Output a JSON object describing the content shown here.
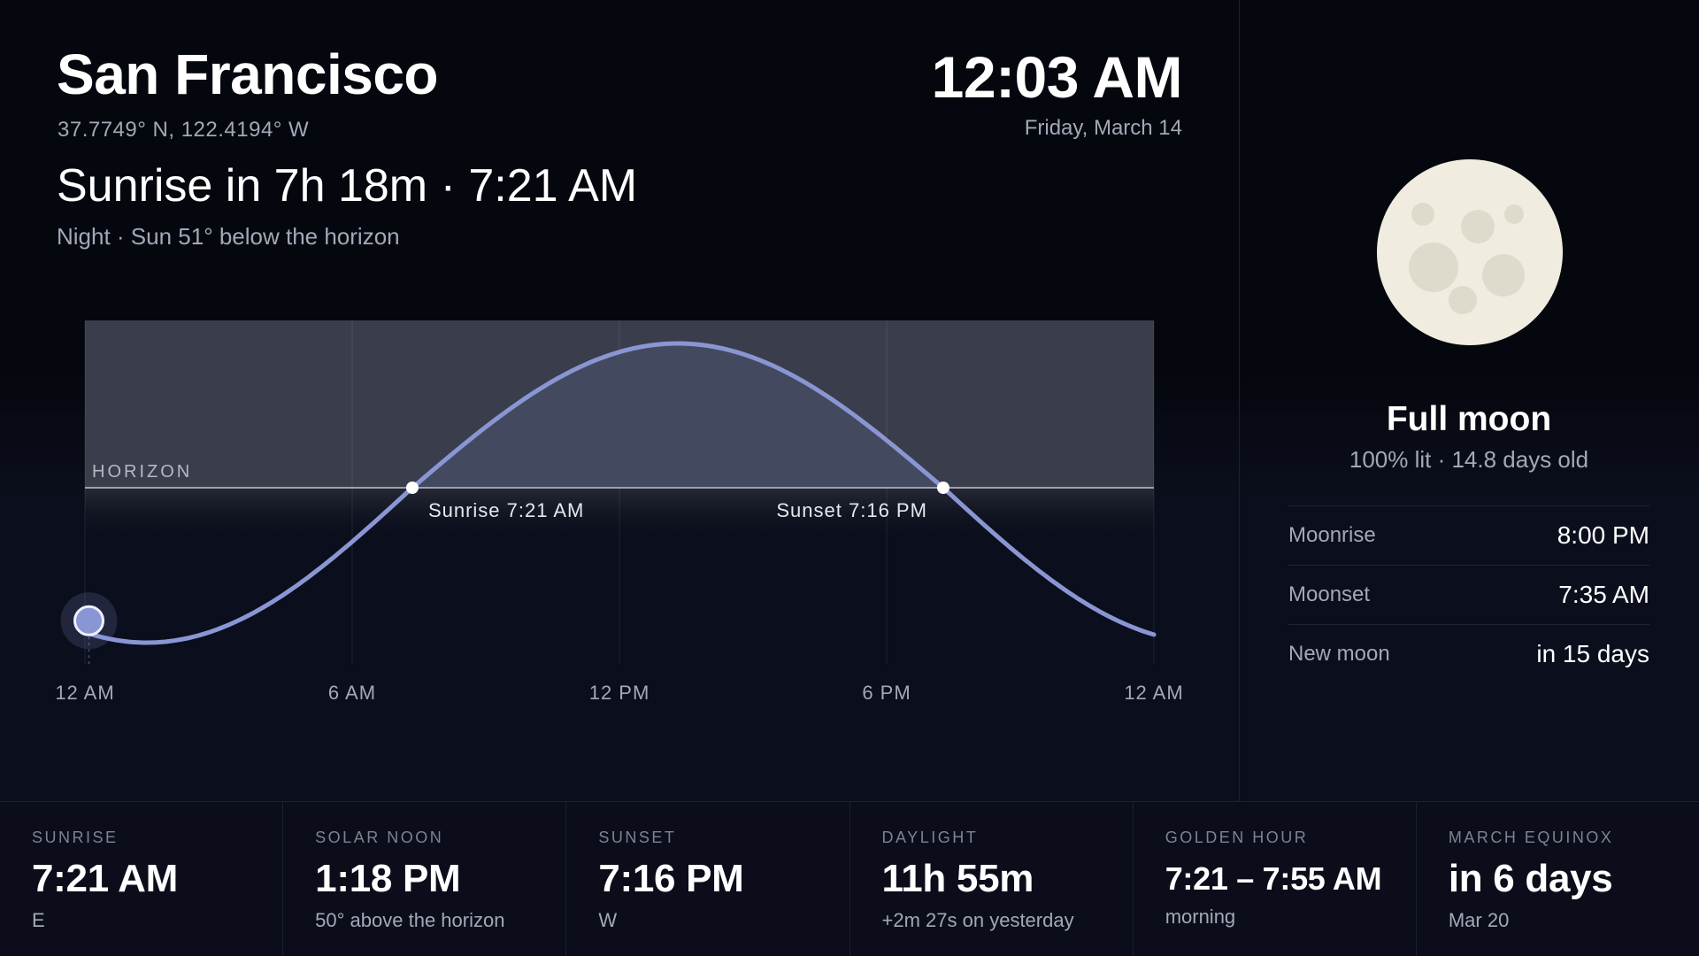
{
  "header": {
    "city": "San Francisco",
    "coords": "37.7749° N, 122.4194° W",
    "time": "12:03 AM",
    "date": "Friday, March 14",
    "headline": "Sunrise in 7h 18m · 7:21 AM",
    "subline": "Night · Sun 51° below the horizon"
  },
  "chart_data": {
    "type": "area",
    "horizon_label": "HORIZON",
    "x_ticks": [
      "12 AM",
      "6 AM",
      "12 PM",
      "6 PM",
      "12 AM"
    ],
    "x_range_hours": [
      0,
      24
    ],
    "sunrise_hour": 7.35,
    "sunset_hour": 19.27,
    "solar_noon_hour": 13.3,
    "max_altitude_deg": 50,
    "current_hour": 0.05,
    "current_altitude_deg": -51,
    "events": [
      {
        "label": "Sunrise 7:21 AM",
        "hour": 7.35
      },
      {
        "label": "Sunset 7:16 PM",
        "hour": 19.27
      }
    ],
    "colors": {
      "curve": "#8a96d3",
      "current_marker": "#8a96d3",
      "day_band": "#3a3d4b"
    }
  },
  "moon": {
    "icon": "full-moon-icon",
    "phase": "Full moon",
    "lit": "100% lit · 14.8 days old",
    "rows": [
      {
        "label": "Moonrise",
        "value": "8:00 PM"
      },
      {
        "label": "Moonset",
        "value": "7:35 AM"
      },
      {
        "label": "New moon",
        "value": "in 15 days"
      }
    ]
  },
  "stats": [
    {
      "label": "SUNRISE",
      "value": "7:21 AM",
      "sub": "E"
    },
    {
      "label": "SOLAR NOON",
      "value": "1:18 PM",
      "sub": "50° above the horizon"
    },
    {
      "label": "SUNSET",
      "value": "7:16 PM",
      "sub": "W"
    },
    {
      "label": "DAYLIGHT",
      "value": "11h 55m",
      "sub": "+2m 27s on yesterday"
    },
    {
      "label": "GOLDEN HOUR",
      "value": "7:21 – 7:55 AM",
      "sub": "morning"
    },
    {
      "label": "MARCH EQUINOX",
      "value": "in 6 days",
      "sub": "Mar 20"
    }
  ]
}
